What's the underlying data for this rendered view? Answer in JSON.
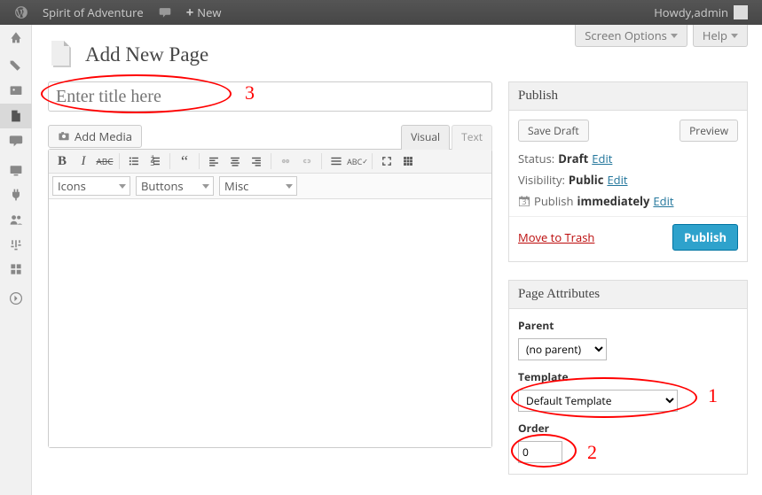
{
  "adminbar": {
    "site_name": "Spirit of Adventure",
    "new_label": "New",
    "howdy_prefix": "Howdy, ",
    "user_name": "admin"
  },
  "screenmeta": {
    "screen_options": "Screen Options",
    "help": "Help"
  },
  "heading": "Add New Page",
  "title_placeholder": "Enter title here",
  "annotations": {
    "one": "1",
    "two": "2",
    "three": "3"
  },
  "media_button": "Add Media",
  "tabs": {
    "visual": "Visual",
    "text": "Text"
  },
  "toolbar_selects": {
    "icons": "Icons",
    "buttons": "Buttons",
    "misc": "Misc"
  },
  "publish_box": {
    "title": "Publish",
    "save_draft": "Save Draft",
    "preview": "Preview",
    "status_label": "Status: ",
    "status_value": "Draft",
    "visibility_label": "Visibility: ",
    "visibility_value": "Public",
    "schedule_label": "Publish ",
    "schedule_value": "immediately",
    "edit": "Edit",
    "trash": "Move to Trash",
    "publish": "Publish"
  },
  "attributes_box": {
    "title": "Page Attributes",
    "parent_label": "Parent",
    "parent_value": "(no parent)",
    "template_label": "Template",
    "template_value": "Default Template",
    "order_label": "Order",
    "order_value": "0"
  }
}
